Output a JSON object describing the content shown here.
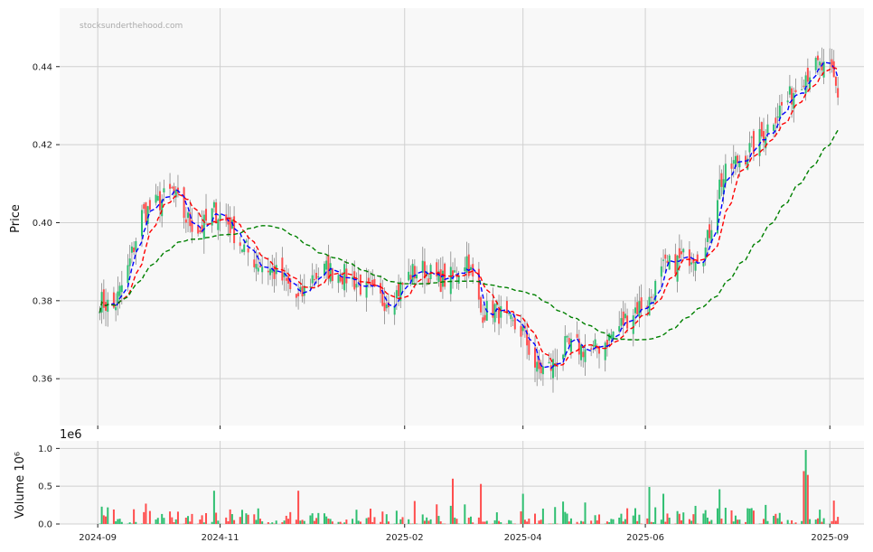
{
  "chart_data": {
    "type": "candlestick",
    "watermark": "stocksunderthehood.com",
    "price_panel": {
      "ylabel": "Price",
      "ylim": [
        0.348,
        0.455
      ],
      "yticks": [
        0.36,
        0.38,
        0.4,
        0.42,
        0.44
      ],
      "ytick_labels": [
        "0.36",
        "0.38",
        "0.40",
        "0.42",
        "0.44"
      ],
      "grid": true,
      "up_color": "#2fbf71",
      "down_color": "#ff4d4d",
      "wick_color": "#888888",
      "anchors": [
        [
          "2024-09-02",
          0.38
        ],
        [
          "2024-09-09",
          0.378
        ],
        [
          "2024-09-16",
          0.388
        ],
        [
          "2024-09-23",
          0.402
        ],
        [
          "2024-10-01",
          0.405
        ],
        [
          "2024-10-08",
          0.408
        ],
        [
          "2024-10-15",
          0.401
        ],
        [
          "2024-10-22",
          0.398
        ],
        [
          "2024-10-29",
          0.403
        ],
        [
          "2024-11-05",
          0.4
        ],
        [
          "2024-11-12",
          0.394
        ],
        [
          "2024-11-19",
          0.39
        ],
        [
          "2024-11-26",
          0.388
        ],
        [
          "2024-12-03",
          0.385
        ],
        [
          "2024-12-10",
          0.38
        ],
        [
          "2024-12-17",
          0.386
        ],
        [
          "2024-12-24",
          0.388
        ],
        [
          "2024-12-31",
          0.387
        ],
        [
          "2025-01-07",
          0.385
        ],
        [
          "2025-01-14",
          0.382
        ],
        [
          "2025-01-21",
          0.38
        ],
        [
          "2025-01-28",
          0.382
        ],
        [
          "2025-02-04",
          0.387
        ],
        [
          "2025-02-11",
          0.388
        ],
        [
          "2025-02-18",
          0.385
        ],
        [
          "2025-02-25",
          0.386
        ],
        [
          "2025-03-04",
          0.391
        ],
        [
          "2025-03-11",
          0.377
        ],
        [
          "2025-03-18",
          0.378
        ],
        [
          "2025-03-25",
          0.374
        ],
        [
          "2025-04-01",
          0.372
        ],
        [
          "2025-04-08",
          0.362
        ],
        [
          "2025-04-15",
          0.363
        ],
        [
          "2025-04-22",
          0.368
        ],
        [
          "2025-04-29",
          0.368
        ],
        [
          "2025-05-06",
          0.367
        ],
        [
          "2025-05-13",
          0.37
        ],
        [
          "2025-05-20",
          0.374
        ],
        [
          "2025-05-27",
          0.378
        ],
        [
          "2025-06-03",
          0.38
        ],
        [
          "2025-06-10",
          0.388
        ],
        [
          "2025-06-17",
          0.39
        ],
        [
          "2025-06-24",
          0.392
        ],
        [
          "2025-07-01",
          0.393
        ],
        [
          "2025-07-08",
          0.41
        ],
        [
          "2025-07-15",
          0.415
        ],
        [
          "2025-07-22",
          0.418
        ],
        [
          "2025-07-29",
          0.422
        ],
        [
          "2025-08-05",
          0.428
        ],
        [
          "2025-08-12",
          0.432
        ],
        [
          "2025-08-19",
          0.438
        ],
        [
          "2025-08-26",
          0.44
        ],
        [
          "2025-09-02",
          0.438
        ],
        [
          "2025-09-05",
          0.433
        ]
      ],
      "lines": [
        {
          "ma": 5,
          "color": "#0000ff",
          "dash": "5,3"
        },
        {
          "ma": 10,
          "color": "#ff0000",
          "dash": "5,3"
        },
        {
          "ma": 50,
          "color": "#008000",
          "dash": "5,3"
        }
      ]
    },
    "volume_panel": {
      "ylabel": "Volume  10⁶",
      "offset_label": "1e6",
      "ylim": [
        0,
        1.1
      ],
      "yticks": [
        0.0,
        0.5,
        1.0
      ],
      "ytick_labels": [
        "0.0",
        "0.5",
        "1.0"
      ],
      "grid": true,
      "spikes": [
        [
          "2024-10-29",
          0.44
        ],
        [
          "2024-12-10",
          0.44
        ],
        [
          "2025-02-25",
          0.6
        ],
        [
          "2025-03-11",
          0.53
        ],
        [
          "2025-04-01",
          0.4
        ],
        [
          "2025-06-03",
          0.49
        ],
        [
          "2025-06-10",
          0.4
        ],
        [
          "2025-07-08",
          0.46
        ],
        [
          "2025-08-19",
          0.7
        ],
        [
          "2025-08-20",
          0.98
        ],
        [
          "2025-08-21",
          0.65
        ]
      ]
    },
    "xaxis": {
      "xlim": [
        "2024-08-13",
        "2025-09-18"
      ],
      "ticks": [
        "2024-09-01",
        "2024-11-01",
        "2025-02-01",
        "2025-04-01",
        "2025-06-01",
        "2025-09-01"
      ],
      "tick_labels": [
        "2024-09",
        "2024-11",
        "2025-02",
        "2025-04",
        "2025-06",
        "2025-09"
      ]
    }
  }
}
